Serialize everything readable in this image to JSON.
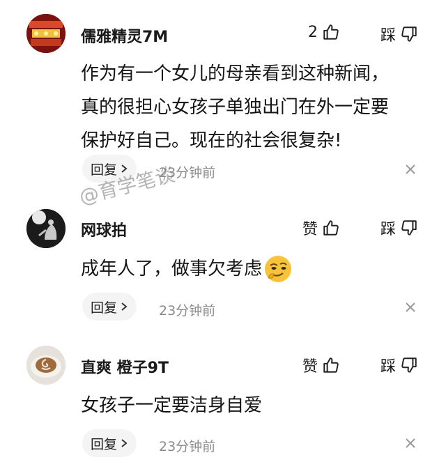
{
  "comments": [
    {
      "username": "儒雅精灵7M",
      "like_label": "2",
      "dislike_label": "踩",
      "content_lines": [
        "作为有一个女儿的母亲看到这种新闻，",
        "真的很担心女孩子单独出门在外一定要",
        "保护好自己。现在的社会很复杂!"
      ],
      "reply_label": "回复",
      "time": "23分钟前"
    },
    {
      "username": "网球拍",
      "like_label": "赞",
      "dislike_label": "踩",
      "content_lines": [
        "成年人了，做事欠考虑"
      ],
      "emoji": "thinking-face-emoji",
      "reply_label": "回复",
      "time": "23分钟前"
    },
    {
      "username": "直爽 橙子9T",
      "like_label": "赞",
      "dislike_label": "踩",
      "content_lines": [
        "女孩子一定要洁身自爱"
      ],
      "reply_label": "回复",
      "time": "23分钟前"
    }
  ],
  "watermark": "@育学笔谈",
  "icons": {
    "like": "thumbs-up-icon",
    "dislike": "thumbs-down-icon",
    "reply_chevron": "chevron-right-icon",
    "close": "close-icon"
  }
}
